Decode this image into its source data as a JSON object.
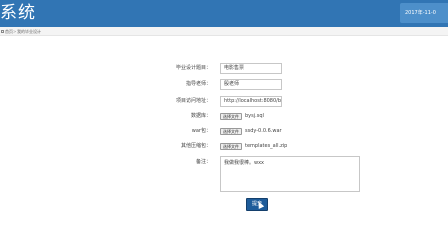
{
  "header": {
    "title": "系统",
    "date": "2017年-11-0"
  },
  "breadcrumb": {
    "home": "首页",
    "separator": ">",
    "current": "我的毕业设计"
  },
  "form": {
    "design_title": {
      "label": "毕业设计题目：",
      "value": "电影售票"
    },
    "advisor": {
      "label": "指导老师：",
      "value": "殷老师"
    },
    "project_url": {
      "label": "项目访问地址：",
      "value": "http://localhost:8080/bi"
    },
    "database": {
      "label": "数据库：",
      "button": "选择文件",
      "file": "bysj.sql"
    },
    "war": {
      "label": "war包：",
      "button": "选择文件",
      "file": "ssdy-0.0.6.war"
    },
    "zip": {
      "label": "其他压缩包：",
      "button": "选择文件",
      "file": "templates_all.zip"
    },
    "note": {
      "label": "备注：",
      "value": "我做我很棒。wxx"
    },
    "submit_label": "提交"
  },
  "colors": {
    "header_bg": "#3175b4",
    "button_bg": "#1e5c9a"
  }
}
